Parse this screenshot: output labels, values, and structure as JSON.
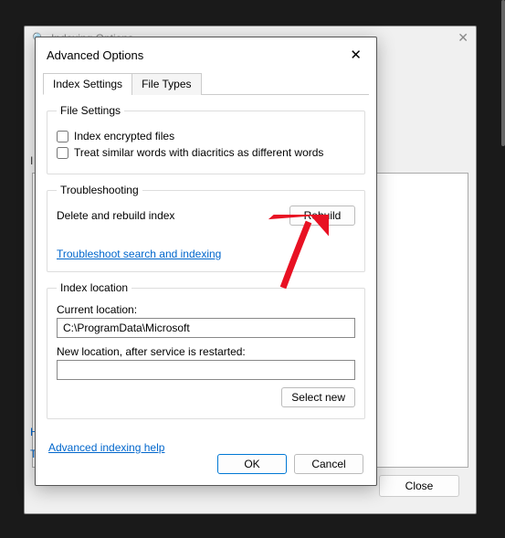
{
  "parent": {
    "title": "Indexing Options",
    "included_label": "I",
    "link1": "H",
    "link2": "T",
    "close_label": "Close"
  },
  "dialog": {
    "title": "Advanced Options",
    "tabs": {
      "index_settings": "Index Settings",
      "file_types": "File Types"
    },
    "file_settings": {
      "legend": "File Settings",
      "encrypted": "Index encrypted files",
      "diacritics": "Treat similar words with diacritics as different words"
    },
    "troubleshooting": {
      "legend": "Troubleshooting",
      "delete_label": "Delete and rebuild index",
      "rebuild_btn": "Rebuild",
      "troubleshoot_link": "Troubleshoot search and indexing"
    },
    "index_location": {
      "legend": "Index location",
      "current_label": "Current location:",
      "current_value": "C:\\ProgramData\\Microsoft",
      "new_label": "New location, after service is restarted:",
      "new_value": "",
      "select_new_btn": "Select new"
    },
    "help_link": "Advanced indexing help",
    "ok": "OK",
    "cancel": "Cancel"
  }
}
